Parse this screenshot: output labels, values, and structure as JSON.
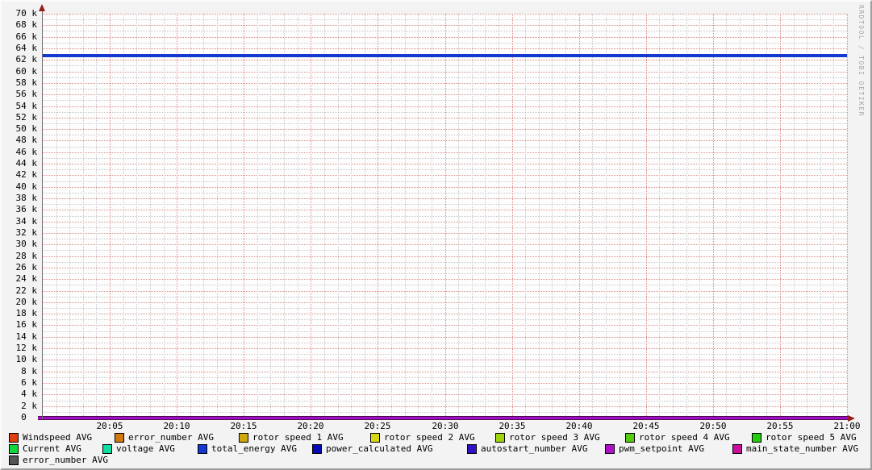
{
  "watermark": "RRDTOOL / TOBI OETIKER",
  "chart_data": {
    "type": "line",
    "title": "",
    "xlabel": "",
    "ylabel": "",
    "grid": true,
    "legend_position": "bottom",
    "x_axis": {
      "start": "20:00",
      "end": "21:00",
      "major_step_minutes": 5,
      "minor_step_minutes": 1,
      "tick_labels": [
        "20:05",
        "20:10",
        "20:15",
        "20:20",
        "20:25",
        "20:30",
        "20:35",
        "20:40",
        "20:45",
        "20:50",
        "20:55",
        "21:00"
      ]
    },
    "y_axis": {
      "min": 0,
      "max": 70000,
      "label_step": 2000,
      "minor_step": 1000,
      "tick_labels": [
        "70 k",
        "68 k",
        "66 k",
        "64 k",
        "62 k",
        "60 k",
        "58 k",
        "56 k",
        "54 k",
        "52 k",
        "50 k",
        "48 k",
        "46 k",
        "44 k",
        "42 k",
        "40 k",
        "38 k",
        "36 k",
        "34 k",
        "32 k",
        "30 k",
        "28 k",
        "26 k",
        "24 k",
        "22 k",
        "20 k",
        "18 k",
        "16 k",
        "14 k",
        "12 k",
        "10 k",
        "8 k",
        "6 k",
        "4 k",
        "2 k",
        "0  "
      ]
    },
    "series": [
      {
        "name": "Windspeed AVG",
        "color": "#e23d0e",
        "value": 0
      },
      {
        "name": "error_number AVG",
        "color": "#d2790c",
        "value": 0
      },
      {
        "name": "rotor speed 1 AVG",
        "color": "#cfa80e",
        "value": 0
      },
      {
        "name": "rotor speed 2 AVG",
        "color": "#d8d511",
        "value": 0
      },
      {
        "name": "rotor speed 3 AVG",
        "color": "#9ed30e",
        "value": 0
      },
      {
        "name": "rotor speed 4 AVG",
        "color": "#55cc0e",
        "value": 0
      },
      {
        "name": "rotor speed 5 AVG",
        "color": "#22cc11",
        "value": 0
      },
      {
        "name": "Current AVG",
        "color": "#0ed83a",
        "value": 0
      },
      {
        "name": "voltage AVG",
        "color": "#0edda0",
        "value": 0
      },
      {
        "name": "total_energy AVG",
        "color": "#1539d0",
        "value": 62700
      },
      {
        "name": "power_calculated AVG",
        "color": "#0a0ab4",
        "value": 0
      },
      {
        "name": "autostart_number AVG",
        "color": "#3311c4",
        "value": 0
      },
      {
        "name": "pwm_setpoint AVG",
        "color": "#b10ecb",
        "value": 0
      },
      {
        "name": "main_state_number AVG",
        "color": "#cb0e9e",
        "value": 0
      },
      {
        "name": "error_number AVG",
        "color": "#555555",
        "value": 0
      }
    ],
    "legend_rows": [
      [
        0,
        1,
        2,
        3,
        4,
        5,
        6
      ],
      [
        7,
        8,
        9,
        10,
        11,
        12,
        13
      ],
      [
        14
      ]
    ],
    "annotations": {
      "visible_flat_line_value": 62700,
      "zero_line_color": "#9a10c8"
    }
  }
}
